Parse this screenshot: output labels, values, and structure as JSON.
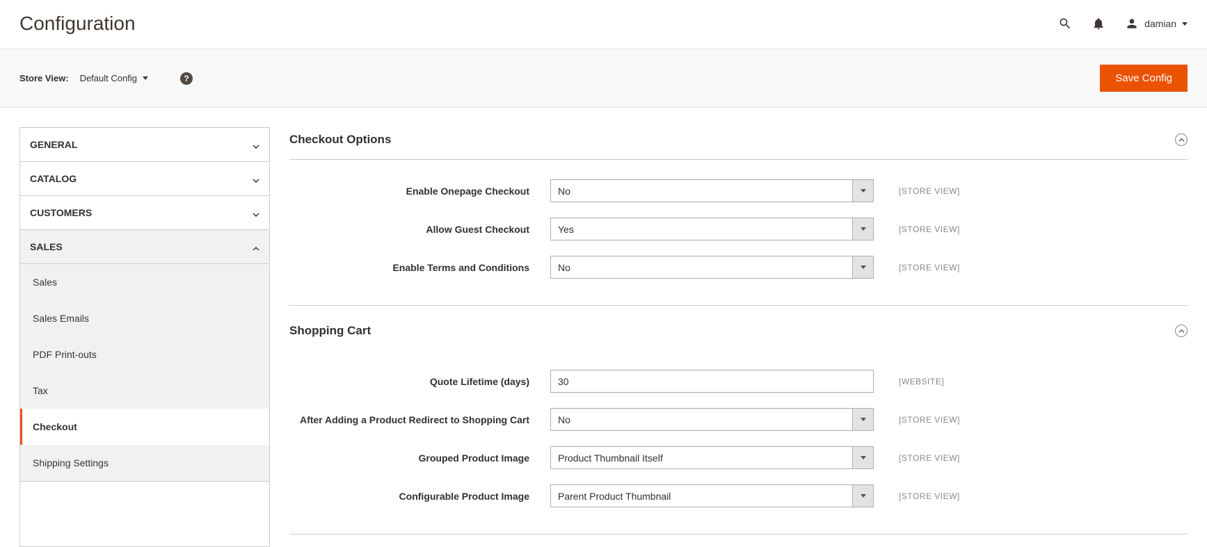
{
  "header": {
    "title": "Configuration",
    "username": "damian"
  },
  "scopeBar": {
    "label": "Store View:",
    "value": "Default Config",
    "saveLabel": "Save Config",
    "helpGlyph": "?"
  },
  "sidebar": {
    "sections": [
      {
        "label": "GENERAL",
        "open": false
      },
      {
        "label": "CATALOG",
        "open": false
      },
      {
        "label": "CUSTOMERS",
        "open": false
      },
      {
        "label": "SALES",
        "open": true,
        "items": [
          {
            "label": "Sales",
            "active": false
          },
          {
            "label": "Sales Emails",
            "active": false
          },
          {
            "label": "PDF Print-outs",
            "active": false
          },
          {
            "label": "Tax",
            "active": false
          },
          {
            "label": "Checkout",
            "active": true
          },
          {
            "label": "Shipping Settings",
            "active": false
          }
        ]
      }
    ]
  },
  "sections": [
    {
      "title": "Checkout Options",
      "fields": [
        {
          "label": "Enable Onepage Checkout",
          "type": "select",
          "value": "No",
          "scope": "[STORE VIEW]"
        },
        {
          "label": "Allow Guest Checkout",
          "type": "select",
          "value": "Yes",
          "scope": "[STORE VIEW]"
        },
        {
          "label": "Enable Terms and Conditions",
          "type": "select",
          "value": "No",
          "scope": "[STORE VIEW]"
        }
      ]
    },
    {
      "title": "Shopping Cart",
      "fields": [
        {
          "label": "Quote Lifetime (days)",
          "type": "text",
          "value": "30",
          "scope": "[WEBSITE]"
        },
        {
          "label": "After Adding a Product Redirect to Shopping Cart",
          "type": "select",
          "value": "No",
          "scope": "[STORE VIEW]"
        },
        {
          "label": "Grouped Product Image",
          "type": "select",
          "value": "Product Thumbnail Itself",
          "scope": "[STORE VIEW]"
        },
        {
          "label": "Configurable Product Image",
          "type": "select",
          "value": "Parent Product Thumbnail",
          "scope": "[STORE VIEW]"
        }
      ]
    }
  ]
}
